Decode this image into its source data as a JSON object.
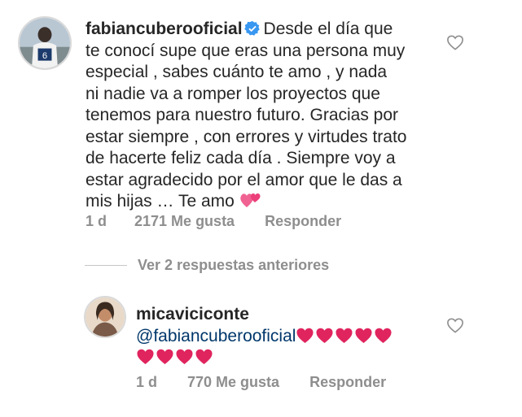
{
  "comments": [
    {
      "username": "fabiancuberooficial",
      "verified": true,
      "text_lines": [
        "Desde el día que",
        "te conocí supe que eras una persona muy",
        "especial , sabes cuánto te amo , y nada",
        "ni nadie va a romper los proyectos que",
        "tenemos para nuestro futuro.  Gracias por",
        "estar siempre , con errores y virtudes trato",
        "de hacerte feliz cada día . Siempre voy a",
        "estar agradecido por el amor que le das a",
        "mis hijas … Te amo"
      ],
      "trailing_emoji": "two-hearts-icon",
      "time": "1 d",
      "likes": "2171 Me gusta",
      "reply_label": "Responder"
    },
    {
      "username": "micaviciconte",
      "mention": "@fabiancuberooficial",
      "hearts_line1": 5,
      "hearts_line2": 4,
      "time": "1 d",
      "likes": "770 Me gusta",
      "reply_label": "Responder"
    }
  ],
  "view_replies_label": "Ver 2 respuestas anteriores",
  "colors": {
    "text": "#262626",
    "meta": "#8e8e8e",
    "mention": "#00376b",
    "verified": "#3897f0",
    "heart_emoji": "#e0245e",
    "pink_hearts": "#f06292"
  }
}
